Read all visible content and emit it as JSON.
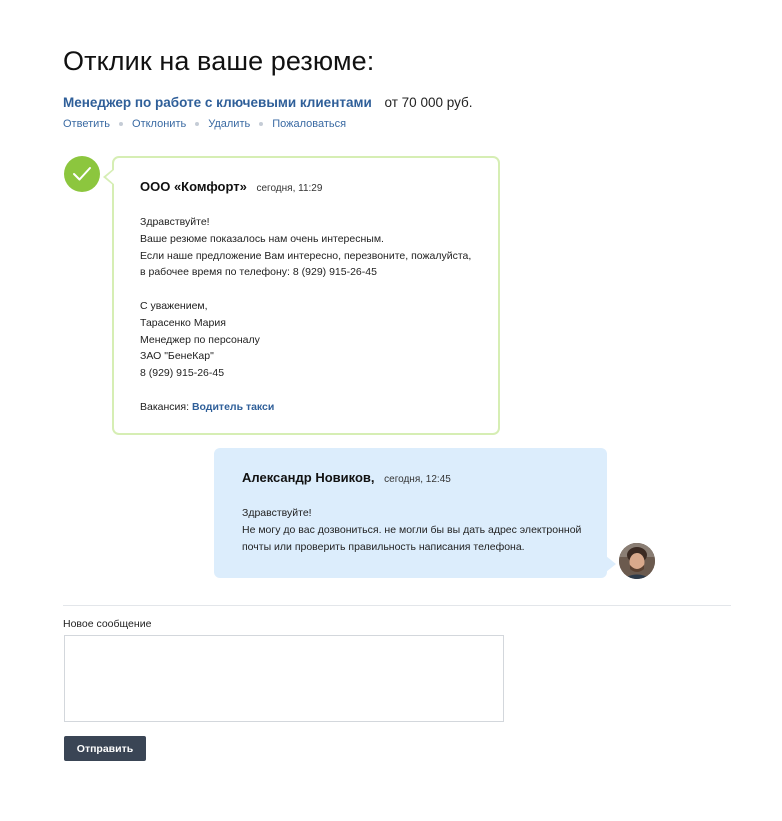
{
  "header": {
    "title": "Отклик на ваше резюме:",
    "vacancy_link": "Менеджер по работе с ключевыми клиентами",
    "salary": "от 70 000 руб."
  },
  "actions": [
    "Ответить",
    "Отклонить",
    "Удалить",
    "Пожаловаться"
  ],
  "employer_message": {
    "sender": "ООО «Комфорт»",
    "time": "сегодня, 11:29",
    "paragraph1": [
      "Здравствуйте!",
      "Ваше резюме показалось нам очень интересным.",
      "Если наше предложение Вам интересно, перезвоните, пожалуйста,",
      "в рабочее время по телефону: 8 (929) 915-26-45"
    ],
    "paragraph2": [
      "С уважением,",
      "Тарасенко Мария",
      "Менеджер по персоналу",
      "ЗАО \"БенеКар\"",
      "8 (929) 915-26-45"
    ],
    "vacancy_prefix": "Вакансия:",
    "vacancy_link": "Водитель такси"
  },
  "applicant_message": {
    "sender": "Александр Новиков,",
    "time": "сегодня, 12:45",
    "lines": [
      "Здравствуйте!",
      "Не могу до вас дозвониться. не могли бы вы дать адрес электронной",
      "почты или проверить правильность написания телефона."
    ]
  },
  "compose": {
    "label": "Новое сообщение",
    "value": "",
    "send_label": "Отправить"
  },
  "colors": {
    "accent_link": "#2f5f99",
    "check_green": "#8cc63e",
    "employer_border": "#d6eeb4",
    "applicant_bg": "#dcedfc",
    "button_bg": "#3a4555"
  }
}
